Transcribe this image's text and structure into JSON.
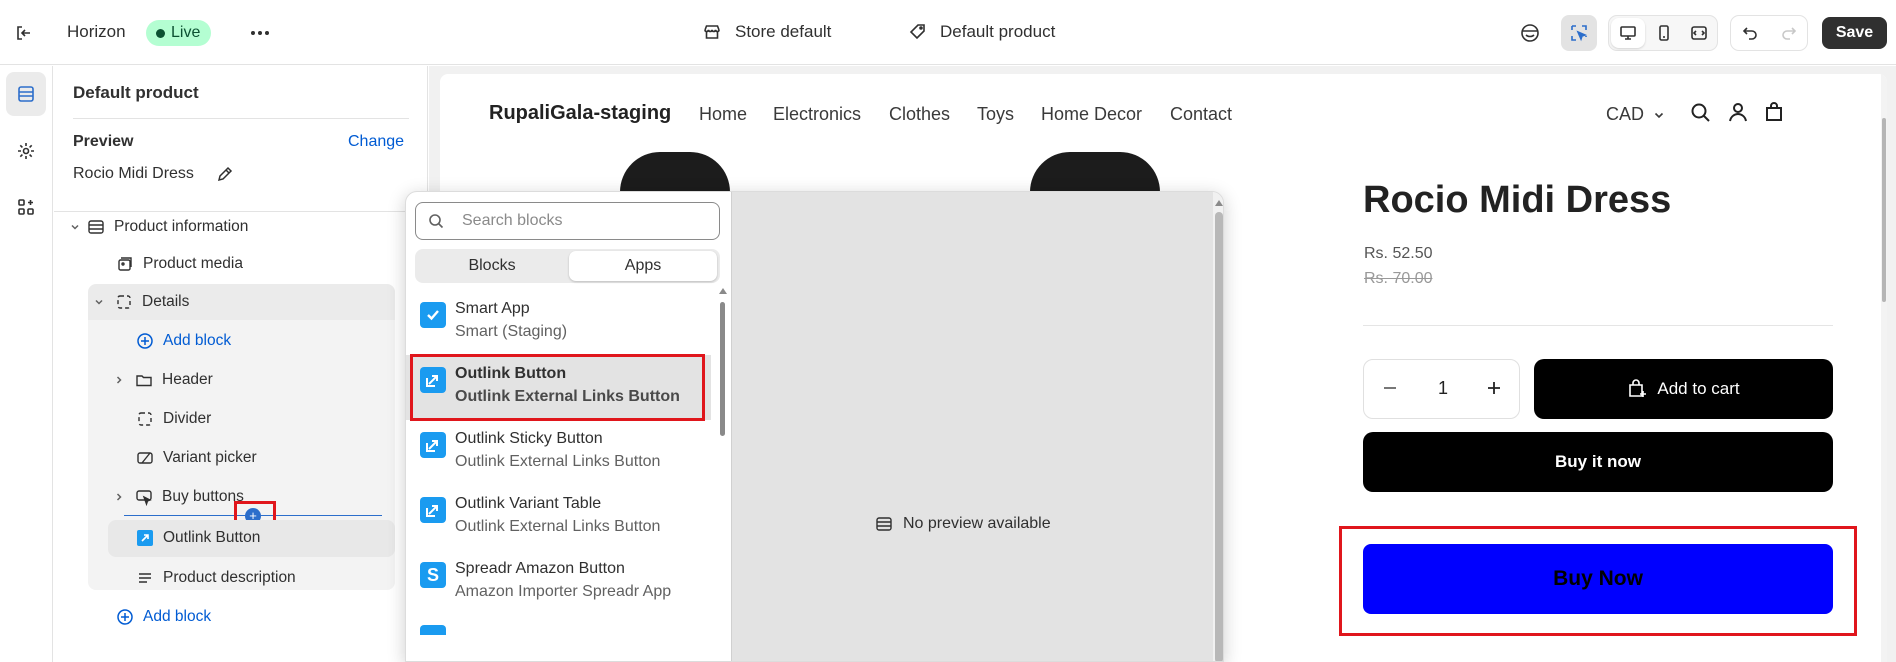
{
  "topbar": {
    "theme_name": "Horizon",
    "status_badge": "Live",
    "store_context": "Store default",
    "template": "Default product",
    "save_label": "Save"
  },
  "sidebar": {
    "title": "Default product",
    "preview_label": "Preview",
    "change_link": "Change",
    "preview_product": "Rocio Midi Dress",
    "tree": {
      "section": "Product information",
      "product_media": "Product media",
      "details": "Details",
      "add_block_inner": "Add block",
      "header": "Header",
      "divider": "Divider",
      "variant_picker": "Variant picker",
      "buy_buttons": "Buy buttons",
      "outlink_button": "Outlink Button",
      "product_description": "Product description",
      "add_block_outer": "Add block"
    }
  },
  "picker": {
    "search_placeholder": "Search blocks",
    "tabs": [
      "Blocks",
      "Apps"
    ],
    "active_tab": "Apps",
    "items": [
      {
        "title": "Smart App",
        "subtitle": "Smart (Staging)",
        "icon": "checkbox-icon",
        "color": "#1a9bf0"
      },
      {
        "title": "Outlink Button",
        "subtitle": "Outlink External Links Button",
        "icon": "outlink-icon",
        "color": "#1a9bf0"
      },
      {
        "title": "Outlink Sticky Button",
        "subtitle": "Outlink External Links Button",
        "icon": "outlink-icon",
        "color": "#1a9bf0"
      },
      {
        "title": "Outlink Variant Table",
        "subtitle": "Outlink External Links Button",
        "icon": "outlink-icon",
        "color": "#1a9bf0"
      },
      {
        "title": "Spreadr Amazon Button",
        "subtitle": "Amazon Importer Spreadr App",
        "icon": "spreadr-icon",
        "color": "#1a9bf0"
      }
    ],
    "no_preview": "No preview available"
  },
  "store": {
    "name": "RupaliGala-staging",
    "nav": [
      "Home",
      "Electronics",
      "Clothes",
      "Toys",
      "Home Decor",
      "Contact"
    ],
    "currency": "CAD",
    "product_title": "Rocio Midi Dress",
    "price": "Rs. 52.50",
    "compare_price": "Rs. 70.00",
    "quantity": "1",
    "add_to_cart": "Add to cart",
    "buy_it_now": "Buy it now",
    "buy_now": "Buy Now",
    "buy_now_color": "#0000ff"
  }
}
